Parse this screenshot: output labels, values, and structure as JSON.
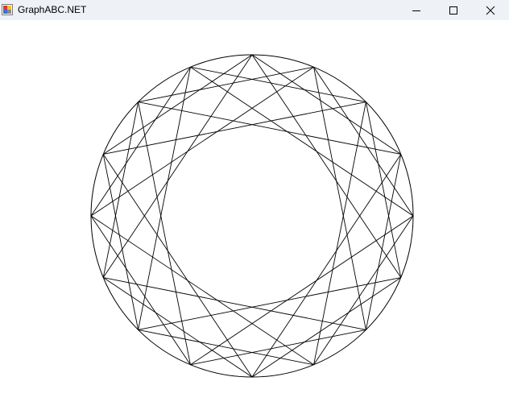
{
  "window": {
    "title": "GraphABC.NET",
    "app_icon": "graphabc-app-icon",
    "controls": {
      "minimize_icon": "minimize-icon",
      "maximize_icon": "maximize-icon",
      "close_icon": "close-icon"
    }
  },
  "figure": {
    "shape": "circle with chords",
    "chord_groups": [
      {
        "points": 16,
        "step": 5
      },
      {
        "points": 16,
        "step": 3
      }
    ],
    "stroke_color": "#000000",
    "background_color": "#ffffff"
  }
}
